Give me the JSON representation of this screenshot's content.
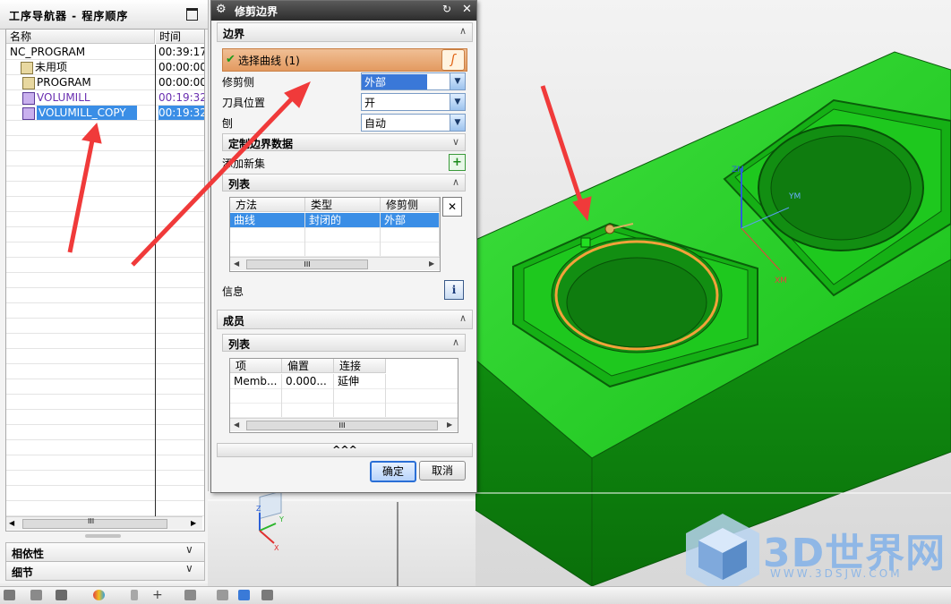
{
  "navigator": {
    "title": "工序导航器 - 程序顺序",
    "col_name": "名称",
    "col_time": "时间",
    "rows": [
      {
        "name": "NC_PROGRAM",
        "time": "00:39:17"
      },
      {
        "name": "未用项",
        "time": "00:00:00"
      },
      {
        "name": "PROGRAM",
        "time": "00:00:00"
      },
      {
        "name": "VOLUMILL",
        "time": "00:19:32"
      },
      {
        "name": "VOLUMILL_COPY",
        "time": "00:19:32"
      }
    ],
    "scroll_mark": "III",
    "panel_dependencies": "相依性",
    "panel_details": "细节"
  },
  "dialog": {
    "title": "修剪边界",
    "section_boundary": "边界",
    "select_curve": "选择曲线 (1)",
    "trim_side_label": "修剪侧",
    "trim_side_value": "外部",
    "tool_position_label": "刀具位置",
    "tool_position_value": "开",
    "plane_label": "刨",
    "plane_value": "自动",
    "custom_boundary_data": "定制边界数据",
    "add_new_set": "添加新集",
    "list_section": "列表",
    "list_headers": [
      "方法",
      "类型",
      "修剪侧"
    ],
    "list_rows": [
      [
        "曲线",
        "封闭的",
        "外部"
      ]
    ],
    "info_label": "信息",
    "section_members": "成员",
    "members_list_section": "列表",
    "members_headers": [
      "项",
      "偏置",
      "连接"
    ],
    "members_rows": [
      [
        "Memb...",
        "0.000...",
        "延伸"
      ]
    ],
    "scroll_mark": "III",
    "more_mark": "^^^",
    "ok": "确定",
    "cancel": "取消"
  },
  "viewport": {
    "axis_labels": {
      "z": "ZM",
      "y": "YM",
      "x": "XM"
    },
    "triad_labels": {
      "z": "Z",
      "y": "Y",
      "x": "X"
    }
  },
  "watermark": {
    "brand": "3D世界网",
    "url": "WWW.3DSJW.COM"
  },
  "colors": {
    "part_green": "#17c417",
    "part_dark": "#0d7a0d",
    "highlight_curve": "#f2a23a",
    "arrow_red": "#f03a3a",
    "selection_blue": "#3a8ee6",
    "watermark": "#8fb7e6"
  }
}
